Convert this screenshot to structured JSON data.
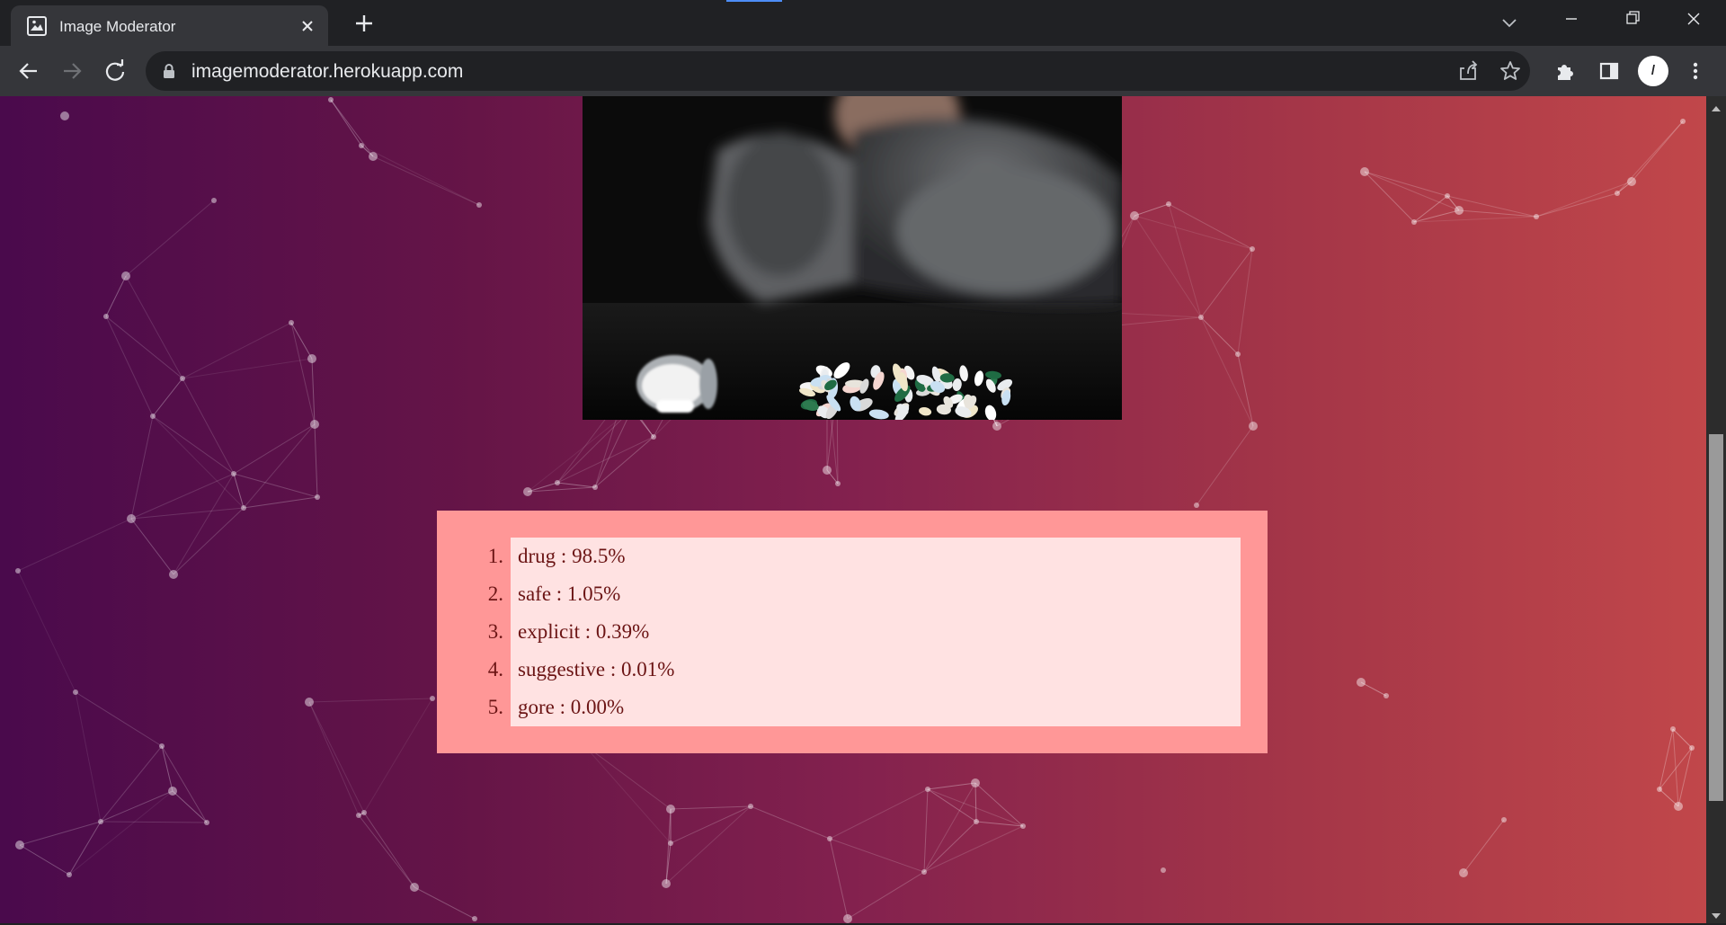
{
  "browser": {
    "tab_title": "Image Moderator",
    "url": "imagemoderator.herokuapp.com",
    "profile_initial": "/"
  },
  "results": [
    {
      "num": "1.",
      "label": "drug",
      "score": "98.5%"
    },
    {
      "num": "2.",
      "label": "safe",
      "score": "1.05%"
    },
    {
      "num": "3.",
      "label": "explicit",
      "score": "0.39%"
    },
    {
      "num": "4.",
      "label": "suggestive",
      "score": "0.01%"
    },
    {
      "num": "5.",
      "label": "gore",
      "score": "0.00%"
    }
  ],
  "icons": {
    "favicon": "image-icon",
    "tab_close": "close-icon",
    "new_tab": "plus-icon",
    "tab_search": "chevron-down-icon",
    "minimize": "minimize-icon",
    "restore": "restore-icon",
    "close_window": "close-icon",
    "back": "back-arrow-icon",
    "forward": "forward-arrow-icon",
    "reload": "reload-icon",
    "lock": "lock-icon",
    "share": "share-icon",
    "bookmark": "star-icon",
    "extensions": "puzzle-icon",
    "side_panel": "side-panel-icon",
    "menu": "kebab-menu-icon"
  },
  "colors": {
    "gradient_start": "#4a0a4c",
    "gradient_end": "#c1474a",
    "panel_outer": "#ff9797",
    "panel_inner": "#ffe2e2",
    "result_text": "#6b1414"
  }
}
